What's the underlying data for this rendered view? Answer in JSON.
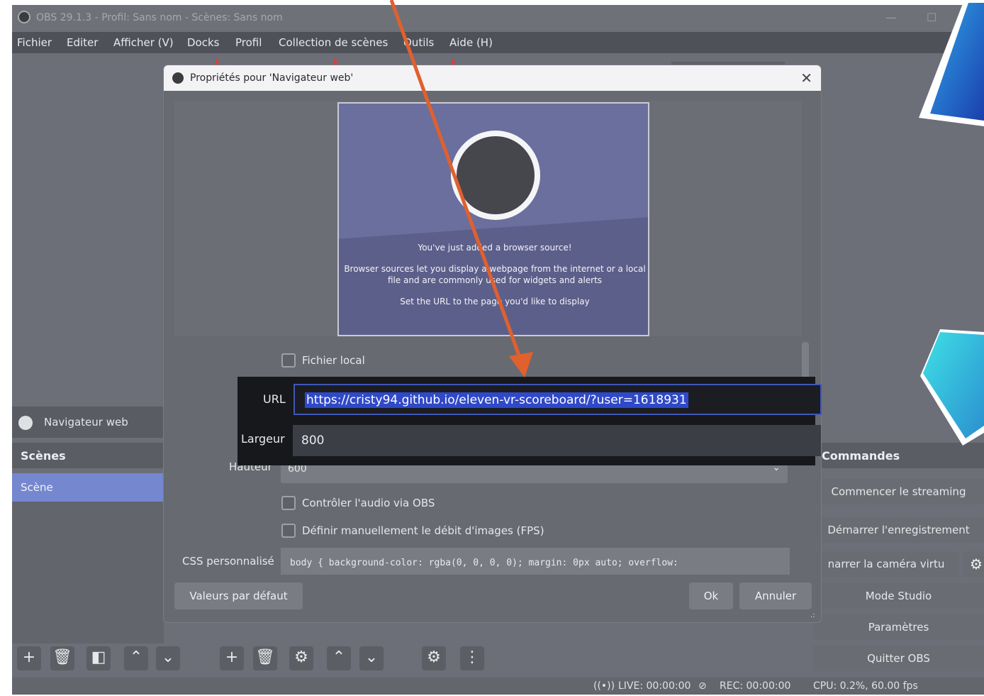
{
  "window": {
    "title": "OBS 29.1.3 - Profil: Sans nom - Scènes: Sans nom"
  },
  "menu": [
    "Fichier",
    "Editer",
    "Afficher (V)",
    "Docks",
    "Profil",
    "Collection de scènes",
    "Outils",
    "Aide (H)"
  ],
  "source_bar": {
    "label": "Navigateur web"
  },
  "scenes": {
    "title": "Scènes",
    "items": [
      "Scène"
    ]
  },
  "commands": {
    "title": "Commandes",
    "buttons": [
      "Commencer le streaming",
      "Démarrer l'enregistrement",
      "narrer la caméra virtu",
      "Mode Studio",
      "Paramètres",
      "Quitter OBS"
    ]
  },
  "status": {
    "live": "LIVE: 00:00:00",
    "rec": "REC: 00:00:00",
    "cpu": "CPU: 0.2%, 60.00 fps"
  },
  "dialog": {
    "title": "Propriétés pour 'Navigateur web'",
    "preview": {
      "line1": "You've just added a browser source!",
      "line2": "Browser sources let you display a webpage from the internet or a local",
      "line3": "file and are commonly used for widgets and alerts",
      "line4": "Set the URL to the page you'd like to display"
    },
    "local_file_label": "Fichier local",
    "url_label": "URL",
    "url_value": "https://cristy94.github.io/eleven-vr-scoreboard/?user=1618931",
    "width_label": "Largeur",
    "width_value": "800",
    "height_label": "Hauteur",
    "height_value": "600",
    "audio_label": "Contrôler l'audio via OBS",
    "fps_label": "Définir manuellement le débit d'images (FPS)",
    "css_label": "CSS personnalisé",
    "css_value": "body { background-color: rgba(0, 0, 0, 0); margin: 0px auto; overflow:",
    "defaults_button": "Valeurs par défaut",
    "ok_button": "Ok",
    "cancel_button": "Annuler"
  },
  "colors": {
    "arrow": "#e0602e",
    "accent": "#2f49c9",
    "deco_blue": "#1e6fd0",
    "deco_cyan": "#3ec7e0"
  }
}
